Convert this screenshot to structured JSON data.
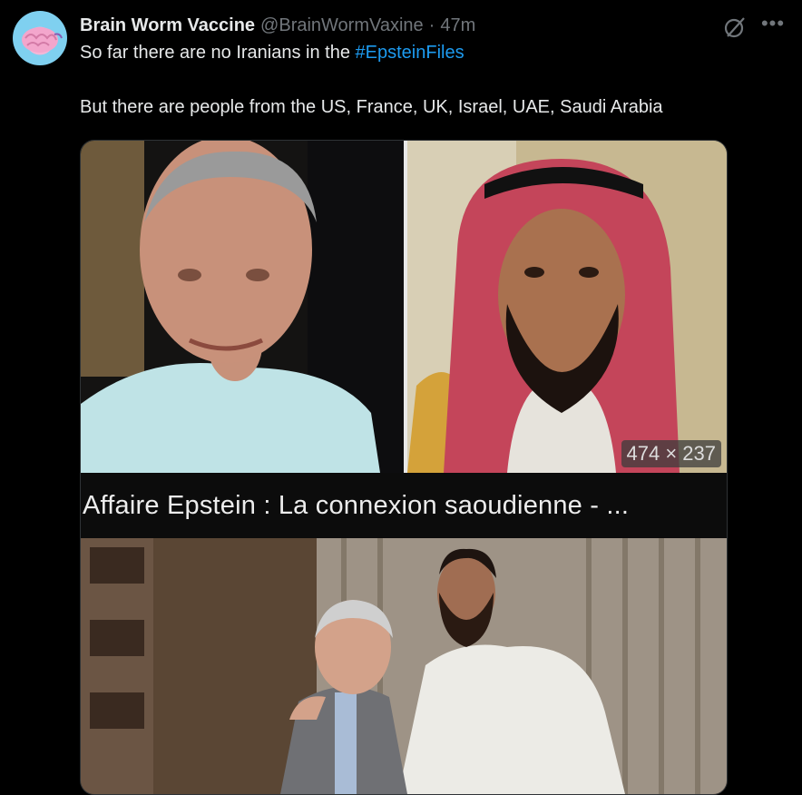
{
  "post": {
    "author_name": "Brain Worm Vaccine",
    "author_handle": "@BrainWormVaxine",
    "separator": "·",
    "time": "47m",
    "text_line1_prefix": "So far there are no Iranians in the ",
    "hashtag": "#EpsteinFiles",
    "text_line2": "But there are people from the US, France, UK, Israel, UAE, Saudi Arabia"
  },
  "media": {
    "dimensions_label": "474 × 237",
    "caption": "Affaire Epstein : La connexion saoudienne - ..."
  },
  "icons": {
    "avatar": "brain-avatar-icon",
    "grok": "grok-icon",
    "more": "more-icon"
  },
  "colors": {
    "background": "#000000",
    "text": "#e7e9ea",
    "secondary": "#71767b",
    "link": "#1d9bf0"
  }
}
